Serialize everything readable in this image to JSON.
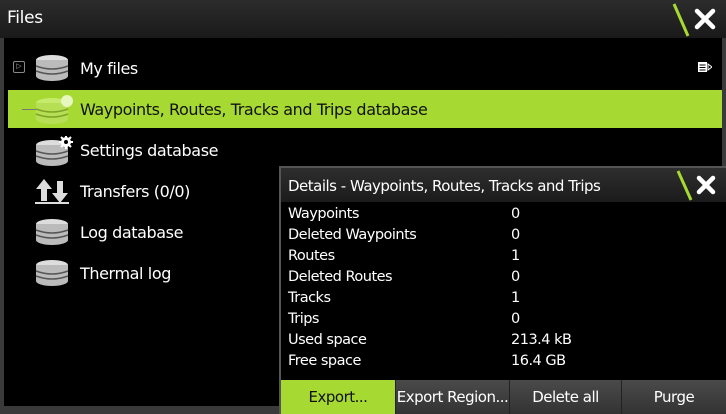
{
  "window": {
    "title": "Files",
    "accent_color": "#a6d931"
  },
  "file_list": [
    {
      "label": "My files",
      "icon": "database-icon",
      "expandable": true
    },
    {
      "label": "Waypoints, Routes, Tracks and Trips database",
      "icon": "database-active-icon",
      "selected": true
    },
    {
      "label": "Settings database",
      "icon": "database-settings-icon"
    },
    {
      "label": "Transfers (0/0)",
      "icon": "transfer-arrows-icon"
    },
    {
      "label": "Log database",
      "icon": "database-icon"
    },
    {
      "label": "Thermal log",
      "icon": "database-icon"
    }
  ],
  "details": {
    "title": "Details - Waypoints, Routes, Tracks and Trips",
    "rows": [
      {
        "key": "Waypoints",
        "value": "0"
      },
      {
        "key": "Deleted Waypoints",
        "value": "0"
      },
      {
        "key": "Routes",
        "value": "1"
      },
      {
        "key": "Deleted Routes",
        "value": "0"
      },
      {
        "key": "Tracks",
        "value": "1"
      },
      {
        "key": "Trips",
        "value": "0"
      },
      {
        "key": "Used space",
        "value": "213.4 kB"
      },
      {
        "key": "Free space",
        "value": "16.4 GB"
      }
    ],
    "buttons": {
      "export": "Export...",
      "export_region": "Export Region...",
      "delete_all": "Delete all",
      "purge": "Purge"
    }
  }
}
